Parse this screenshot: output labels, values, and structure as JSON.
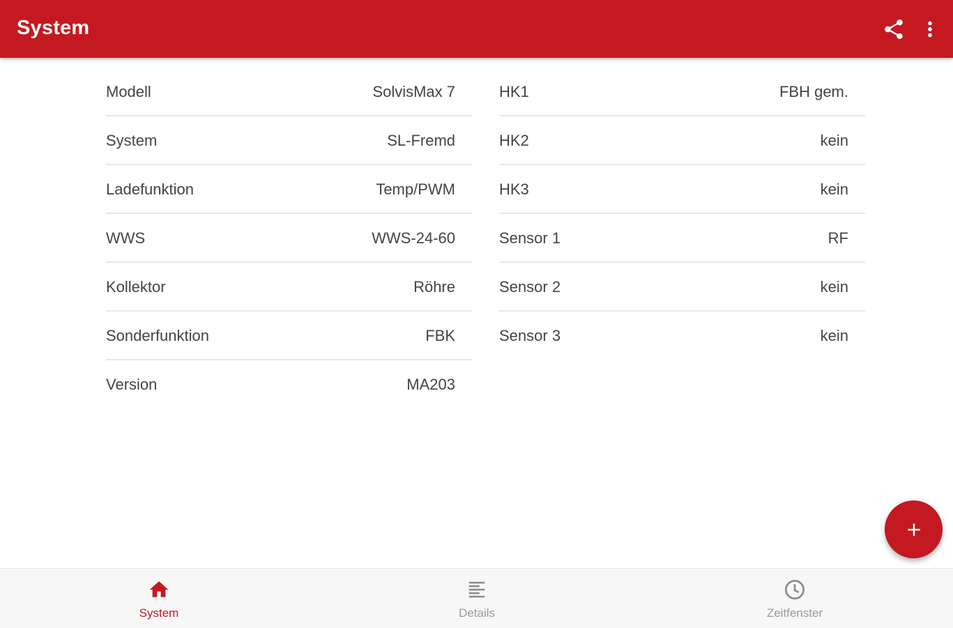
{
  "appbar": {
    "title": "System",
    "bg_color": "#c41920",
    "actions": [
      {
        "icon": "share-icon"
      },
      {
        "icon": "more-vert-icon"
      }
    ]
  },
  "left_rows": [
    {
      "label": "Modell",
      "value": "SolvisMax 7"
    },
    {
      "label": "System",
      "value": "SL-Fremd"
    },
    {
      "label": "Ladefunktion",
      "value": "Temp/PWM"
    },
    {
      "label": "WWS",
      "value": "WWS-24-60"
    },
    {
      "label": "Kollektor",
      "value": "Röhre"
    },
    {
      "label": "Sonderfunktion",
      "value": "FBK"
    },
    {
      "label": "Version",
      "value": "MA203"
    }
  ],
  "right_rows": [
    {
      "label": "HK1",
      "value": "FBH gem."
    },
    {
      "label": "HK2",
      "value": "kein"
    },
    {
      "label": "HK3",
      "value": "kein"
    },
    {
      "label": "Sensor 1",
      "value": "RF"
    },
    {
      "label": "Sensor 2",
      "value": "kein"
    },
    {
      "label": "Sensor 3",
      "value": "kein"
    }
  ],
  "fab": {
    "icon": "plus-icon",
    "color": "#c41920"
  },
  "bottom_nav": {
    "items": [
      {
        "label": "System",
        "icon": "home-icon",
        "active": true
      },
      {
        "label": "Details",
        "icon": "list-icon",
        "active": false
      },
      {
        "label": "Zeitfenster",
        "icon": "clock-icon",
        "active": false
      }
    ],
    "active_color": "#c41920",
    "inactive_color": "#9a9a9a"
  }
}
